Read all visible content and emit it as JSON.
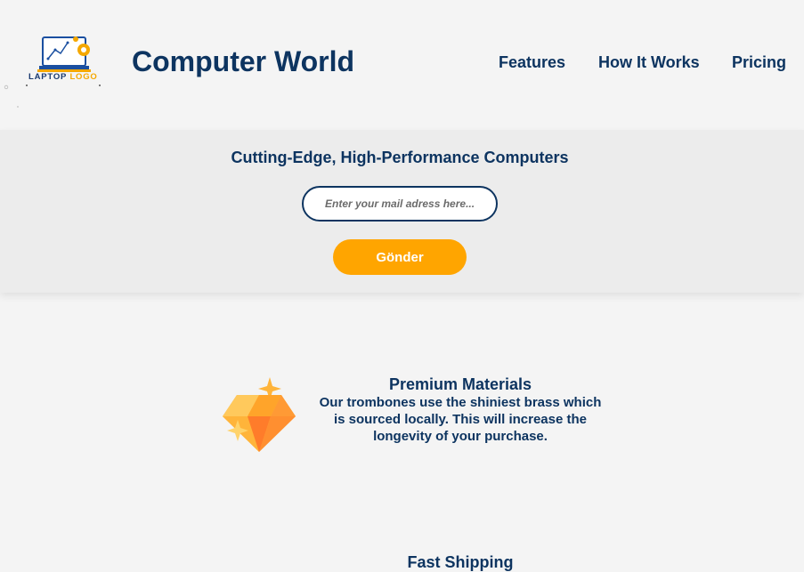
{
  "header": {
    "logo": {
      "word1": "LAPTOP",
      "word2": "LOGO",
      "icon": "laptop-gear-icon"
    },
    "title": "Computer World",
    "nav": [
      {
        "label": "Features"
      },
      {
        "label": "How It Works"
      },
      {
        "label": "Pricing"
      }
    ]
  },
  "hero": {
    "title": "Cutting-Edge, High-Performance Computers",
    "email_placeholder": "Enter your mail adress here...",
    "email_value": "",
    "submit_label": "Gönder"
  },
  "features": [
    {
      "icon": "diamond-icon",
      "title": "Premium Materials",
      "description": "Our trombones use the shiniest brass which is sourced locally. This will increase the longevity of your purchase."
    },
    {
      "title": "Fast Shipping"
    }
  ],
  "colors": {
    "primary": "#0d3460",
    "accent": "#ffa500",
    "background": "#f4f4f4",
    "hero_background": "#ececec"
  }
}
